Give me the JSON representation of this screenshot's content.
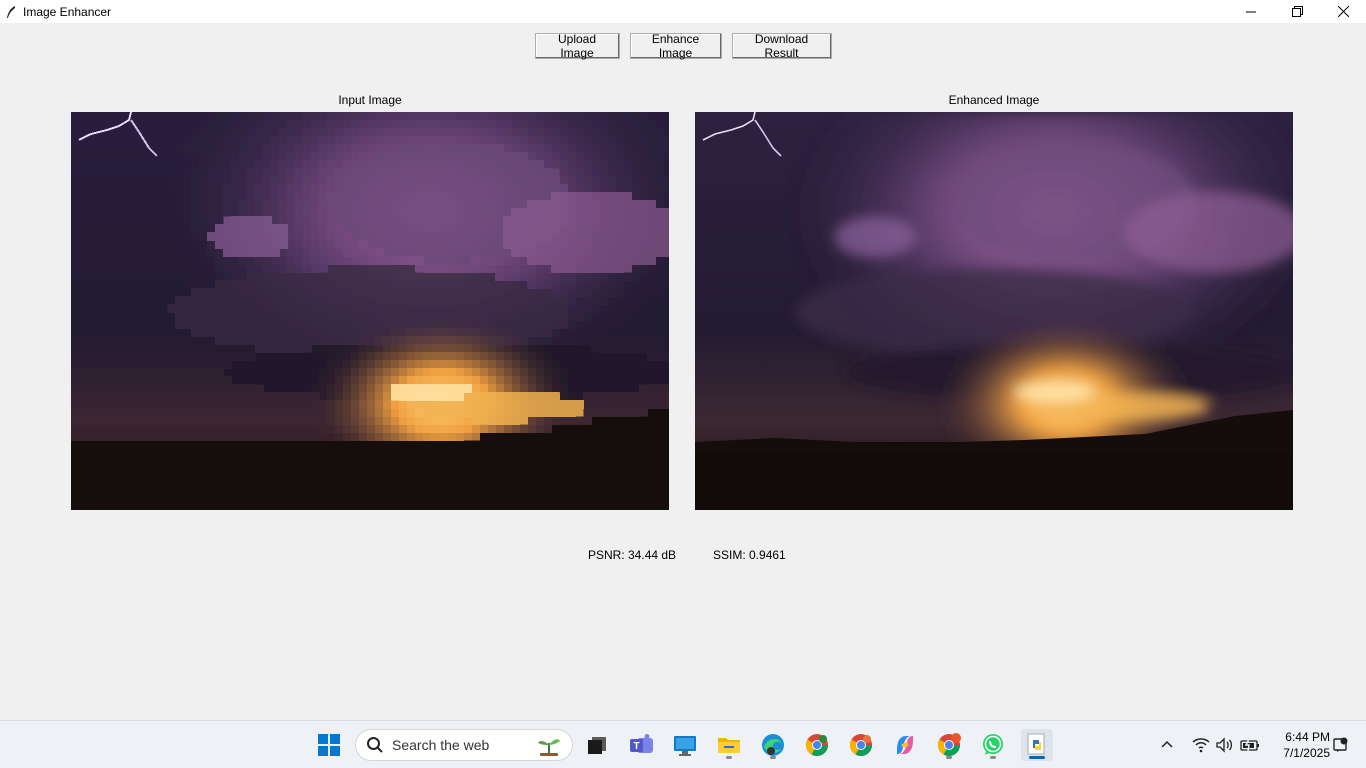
{
  "window": {
    "title": "Image Enhancer",
    "controls": [
      "minimize-icon",
      "restore-icon",
      "close-icon"
    ]
  },
  "toolbar": {
    "upload_label": "Upload Image",
    "enhance_label": "Enhance Image",
    "download_label": "Download Result"
  },
  "panels": {
    "input_label": "Input Image",
    "enhanced_label": "Enhanced Image"
  },
  "metrics": {
    "psnr": "PSNR: 34.44 dB",
    "ssim": "SSIM: 0.9461"
  },
  "taskbar": {
    "search_placeholder": "Search the web",
    "clock_time": "6:44 PM",
    "clock_date": "7/1/2025",
    "apps": [
      "windows-start-icon",
      "task-view-icon",
      "teams-icon",
      "remote-desktop-icon",
      "file-explorer-icon",
      "edge-icon",
      "chrome-icon",
      "chrome-icon",
      "copilot-icon",
      "chrome-icon",
      "whatsapp-icon",
      "python-icon"
    ]
  }
}
